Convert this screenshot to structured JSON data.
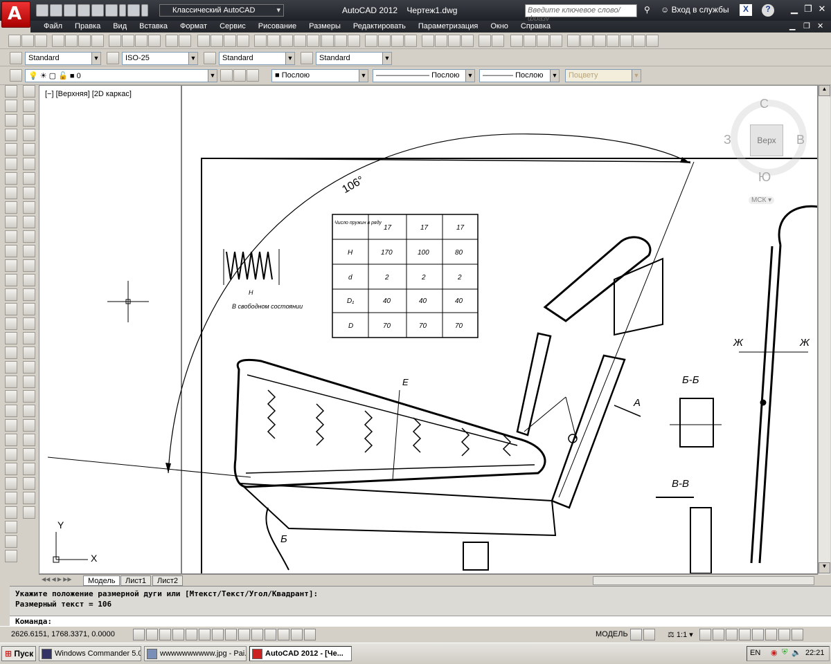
{
  "titlebar": {
    "workspace": "Классический AutoCAD",
    "app_name": "AutoCAD 2012",
    "document": "Чертеж1.dwg",
    "search_placeholder": "Введите ключевое слово/фразу",
    "signin": "Вход в службы",
    "help": "?"
  },
  "menu": [
    "Файл",
    "Правка",
    "Вид",
    "Вставка",
    "Формат",
    "Сервис",
    "Рисование",
    "Размеры",
    "Редактировать",
    "Параметризация",
    "Окно",
    "Справка"
  ],
  "styles_toolbar": {
    "text_style": "Standard",
    "dim_style": "ISO-25",
    "table_style": "Standard",
    "mleader_style": "Standard"
  },
  "layers_toolbar": {
    "layer": "0",
    "color": "Послою",
    "linetype": "Послою",
    "lineweight": "Послою",
    "plotstyle": "Поцвету"
  },
  "viewport": {
    "label": "[−] [Верхняя] [2D каркас]",
    "viewcube": {
      "top_face": "Верх",
      "north": "С",
      "south": "Ю",
      "west": "З",
      "east": "В",
      "ucs": "МСК"
    },
    "ucs_x": "X",
    "ucs_y": "Y"
  },
  "drawing": {
    "dimension_text": "106°",
    "table": {
      "rows": [
        [
          "Число пружин в ряду",
          "17",
          "17",
          "17"
        ],
        [
          "H",
          "170",
          "100",
          "80"
        ],
        [
          "d",
          "2",
          "2",
          "2"
        ],
        [
          "D₁",
          "40",
          "40",
          "40"
        ],
        [
          "D",
          "70",
          "70",
          "70"
        ]
      ]
    },
    "labels": {
      "spring_caption": "В свободном состоянии",
      "section_bb": "Б-Б",
      "section_vv": "В-В",
      "label_zh1": "Ж",
      "label_zh2": "Ж",
      "label_a": "А",
      "label_b": "Б",
      "label_e": "Е",
      "label_h": "Н"
    }
  },
  "tabs": [
    "Модель",
    "Лист1",
    "Лист2"
  ],
  "command": {
    "line1": "Укажите положение размерной дуги или [Мтекст/Текст/Угол/Квадрант]:",
    "line2": "Размерный текст = 106",
    "prompt": "Команда:"
  },
  "status": {
    "coords": "2626.6151, 1768.3371, 0.0000",
    "space": "МОДЕЛЬ",
    "scale": "1:1"
  },
  "taskbar": {
    "start": "Пуск",
    "tasks": [
      "Windows Commander 5.0...",
      "wwwwwwwwww.jpg - Pai...",
      "AutoCAD 2012 - [Че..."
    ],
    "lang": "EN",
    "time": "22:21"
  }
}
